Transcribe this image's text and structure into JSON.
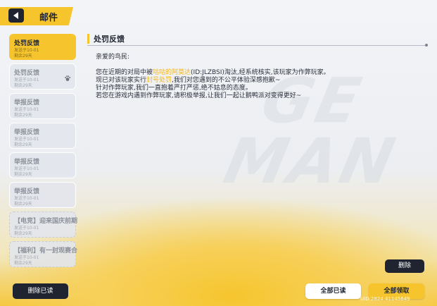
{
  "header": {
    "title": "邮件"
  },
  "mails": [
    {
      "title": "处罚反馈",
      "sent": "发送于10-01",
      "remaining": "剩余29天",
      "active": true
    },
    {
      "title": "处罚反馈",
      "sent": "发送于10-01",
      "remaining": "剩余29天",
      "icon": "paw-icon"
    },
    {
      "title": "举报反馈",
      "sent": "发送于10-01",
      "remaining": "剩余29天"
    },
    {
      "title": "举报反馈",
      "sent": "发送于10-01",
      "remaining": "剩余29天"
    },
    {
      "title": "举报反馈",
      "sent": "发送于10-01",
      "remaining": "剩余29天"
    },
    {
      "title": "举报反馈",
      "sent": "发送于10-01",
      "remaining": "剩余29天"
    },
    {
      "title": "【电竞】迎来国庆前期,…",
      "sent": "发送于10-01",
      "remaining": "剩余29天"
    },
    {
      "title": "【福利】有一封观赛合…",
      "sent": "发送于10-01",
      "remaining": "剩余29天"
    }
  ],
  "buttons": {
    "delete_read": "删除已读",
    "delete": "删除",
    "read_all": "全部已读",
    "claim_all": "全部领取"
  },
  "detail": {
    "title": "处罚反馈",
    "greeting": "亲爱的鸟民:",
    "line1_pre": "您在近期的对局中被",
    "line1_hl": "咕咕的阿莫达",
    "line1_post": "(ID:JLZBSI)淘汰,经系统核实,该玩家为作弊玩家。",
    "line2_pre": "现已对该玩家实行",
    "line2_hl": "封号处罚",
    "line2_post": ",我们对您遇到的不公平体验深感抱歉~",
    "line3": "针对作弊玩家,我们一直抱着严打严惩,绝不姑息的态度。",
    "line4": "若您在游戏内遇到作弊玩家,请积极举报,让我们一起让鹅鸭派对变得更好~"
  },
  "footer": {
    "uid": "UID:2824 41145649"
  },
  "colors": {
    "accent": "#f6c52e",
    "dark": "#1f2430",
    "highlight": "#f2b719"
  }
}
